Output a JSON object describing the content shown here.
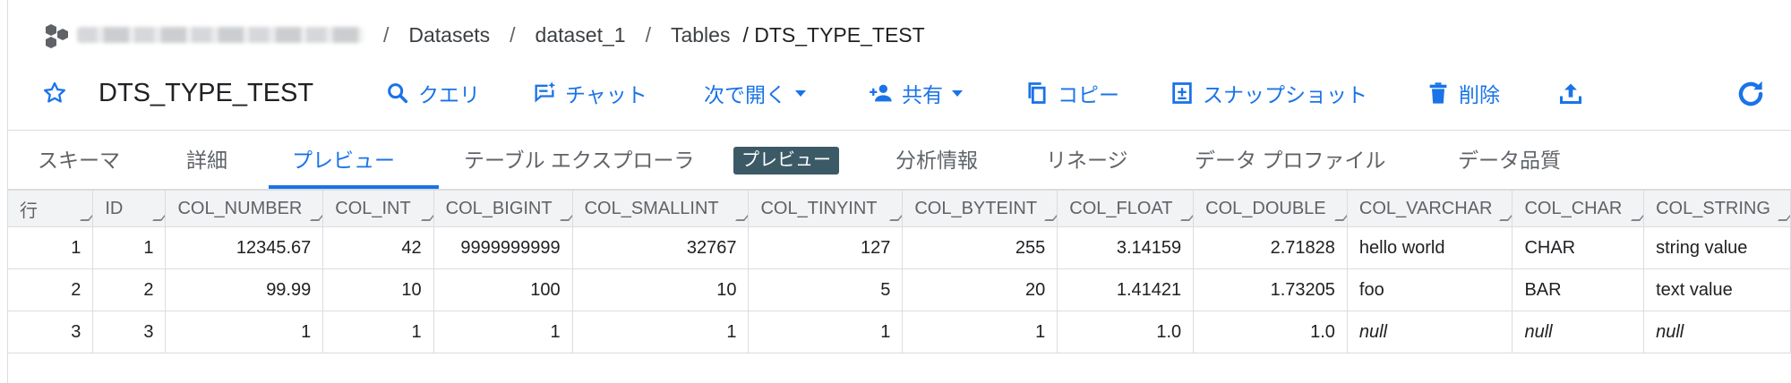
{
  "breadcrumb": {
    "sep": "/",
    "items": [
      "Datasets",
      "dataset_1",
      "Tables"
    ],
    "current": "/ DTS_TYPE_TEST"
  },
  "header": {
    "title": "DTS_TYPE_TEST",
    "actions": {
      "query": "クエリ",
      "chat": "チャット",
      "open_in": "次で開く",
      "share": "共有",
      "copy": "コピー",
      "snapshot": "スナップショット",
      "delete": "削除"
    },
    "accent": "#1a73e8"
  },
  "tabs": {
    "schema": "スキーマ",
    "details": "詳細",
    "preview": "プレビュー",
    "explorer": "テーブル エクスプローラ",
    "explorer_badge": "プレビュー",
    "insights": "分析情報",
    "lineage": "リネージ",
    "profile": "データ プロファイル",
    "quality": "データ品質",
    "active": "preview"
  },
  "table": {
    "columns": [
      "行",
      "ID",
      "COL_NUMBER",
      "COL_INT",
      "COL_BIGINT",
      "COL_SMALLINT",
      "COL_TINYINT",
      "COL_BYTEINT",
      "COL_FLOAT",
      "COL_DOUBLE",
      "COL_VARCHAR",
      "COL_CHAR",
      "COL_STRING"
    ],
    "rows": [
      [
        "1",
        "1",
        "12345.67",
        "42",
        "9999999999",
        "32767",
        "127",
        "255",
        "3.14159",
        "2.71828",
        "hello world",
        "CHAR",
        "string value"
      ],
      [
        "2",
        "2",
        "99.99",
        "10",
        "100",
        "10",
        "5",
        "20",
        "1.41421",
        "1.73205",
        "foo",
        "BAR",
        "text value"
      ],
      [
        "3",
        "3",
        "1",
        "1",
        "1",
        "1",
        "1",
        "1",
        "1.0",
        "1.0",
        "null",
        "null",
        "null"
      ]
    ]
  }
}
